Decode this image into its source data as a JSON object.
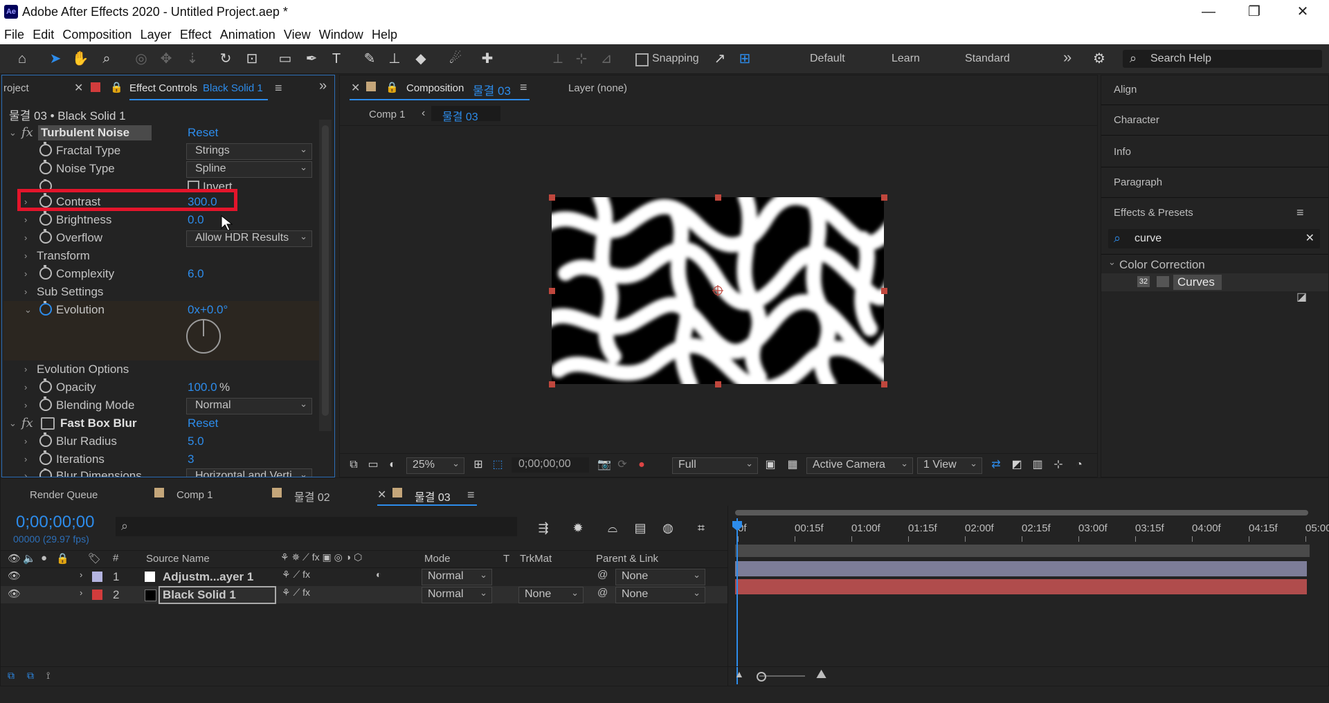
{
  "window": {
    "app_badge": "Ae",
    "title": "Adobe After Effects 2020 - Untitled Project.aep *",
    "minimize": "—",
    "restore": "❐",
    "close": "✕"
  },
  "menu": [
    "File",
    "Edit",
    "Composition",
    "Layer",
    "Effect",
    "Animation",
    "View",
    "Window",
    "Help"
  ],
  "toolbar": {
    "snapping": "Snapping",
    "workspaces": [
      "Default",
      "Learn",
      "Standard"
    ],
    "more": "»",
    "search_placeholder": "Search Help"
  },
  "effect_controls": {
    "project_tab": "roject",
    "tab_label": "Effect Controls",
    "tab_target": "Black Solid 1",
    "header": "물결 03 • Black Solid 1",
    "effect1": {
      "name": "Turbulent Noise",
      "reset": "Reset"
    },
    "props": {
      "fractal_type": {
        "label": "Fractal Type",
        "value": "Strings"
      },
      "noise_type": {
        "label": "Noise Type",
        "value": "Spline"
      },
      "invert": {
        "label": "Invert"
      },
      "contrast": {
        "label": "Contrast",
        "value": "300.0"
      },
      "brightness": {
        "label": "Brightness",
        "value": "0.0"
      },
      "overflow": {
        "label": "Overflow",
        "value": "Allow HDR Results"
      },
      "transform": {
        "label": "Transform"
      },
      "complexity": {
        "label": "Complexity",
        "value": "6.0"
      },
      "sub_settings": {
        "label": "Sub Settings"
      },
      "evolution": {
        "label": "Evolution",
        "value": "0x+0.0°"
      },
      "evolution_options": {
        "label": "Evolution Options"
      },
      "opacity": {
        "label": "Opacity",
        "value": "100.0",
        "unit": "%"
      },
      "blending_mode": {
        "label": "Blending Mode",
        "value": "Normal"
      }
    },
    "effect2": {
      "name": "Fast Box Blur",
      "reset": "Reset"
    },
    "props2": {
      "blur_radius": {
        "label": "Blur Radius",
        "value": "5.0"
      },
      "iterations": {
        "label": "Iterations",
        "value": "3"
      },
      "blur_dimensions": {
        "label": "Blur Dimensions",
        "value": "Horizontal and Verti"
      }
    }
  },
  "composition": {
    "tab_label": "Composition",
    "tab_name": "물결 03",
    "layer_tab": "Layer (none)",
    "breadcrumb": [
      "Comp 1",
      "물결 03"
    ],
    "footer": {
      "zoom": "25%",
      "timecode": "0;00;00;00",
      "resolution": "Full",
      "camera": "Active Camera",
      "views": "1 View"
    }
  },
  "right_panels": {
    "items": [
      "Align",
      "Character",
      "Info",
      "Paragraph"
    ],
    "effects_presets": "Effects & Presets",
    "search_value": "curve",
    "folder": "Color Correction",
    "result": "Curves",
    "result_badge": "32"
  },
  "timeline": {
    "tabs": [
      "Render Queue",
      "Comp 1",
      "물결 02",
      "물결 03"
    ],
    "timecode": "0;00;00;00",
    "frame_info": "00000 (29.97 fps)",
    "columns": {
      "num": "#",
      "source": "Source Name",
      "mode": "Mode",
      "t": "T",
      "trkmat": "TrkMat",
      "parent": "Parent & Link"
    },
    "ruler": [
      "0f",
      "00:15f",
      "01:00f",
      "01:15f",
      "02:00f",
      "02:15f",
      "03:00f",
      "03:15f",
      "04:00f",
      "04:15f",
      "05:00"
    ],
    "layers": [
      {
        "num": "1",
        "name": "Adjustm...ayer 1",
        "mode": "Normal",
        "trkmat": "",
        "parent": "None",
        "label_color": "#b4b4e0",
        "bar_color": "#7d7d98"
      },
      {
        "num": "2",
        "name": "Black Solid 1",
        "mode": "Normal",
        "trkmat": "None",
        "parent": "None",
        "label_color": "#d23c3c",
        "bar_color": "#b04c4c"
      }
    ]
  }
}
